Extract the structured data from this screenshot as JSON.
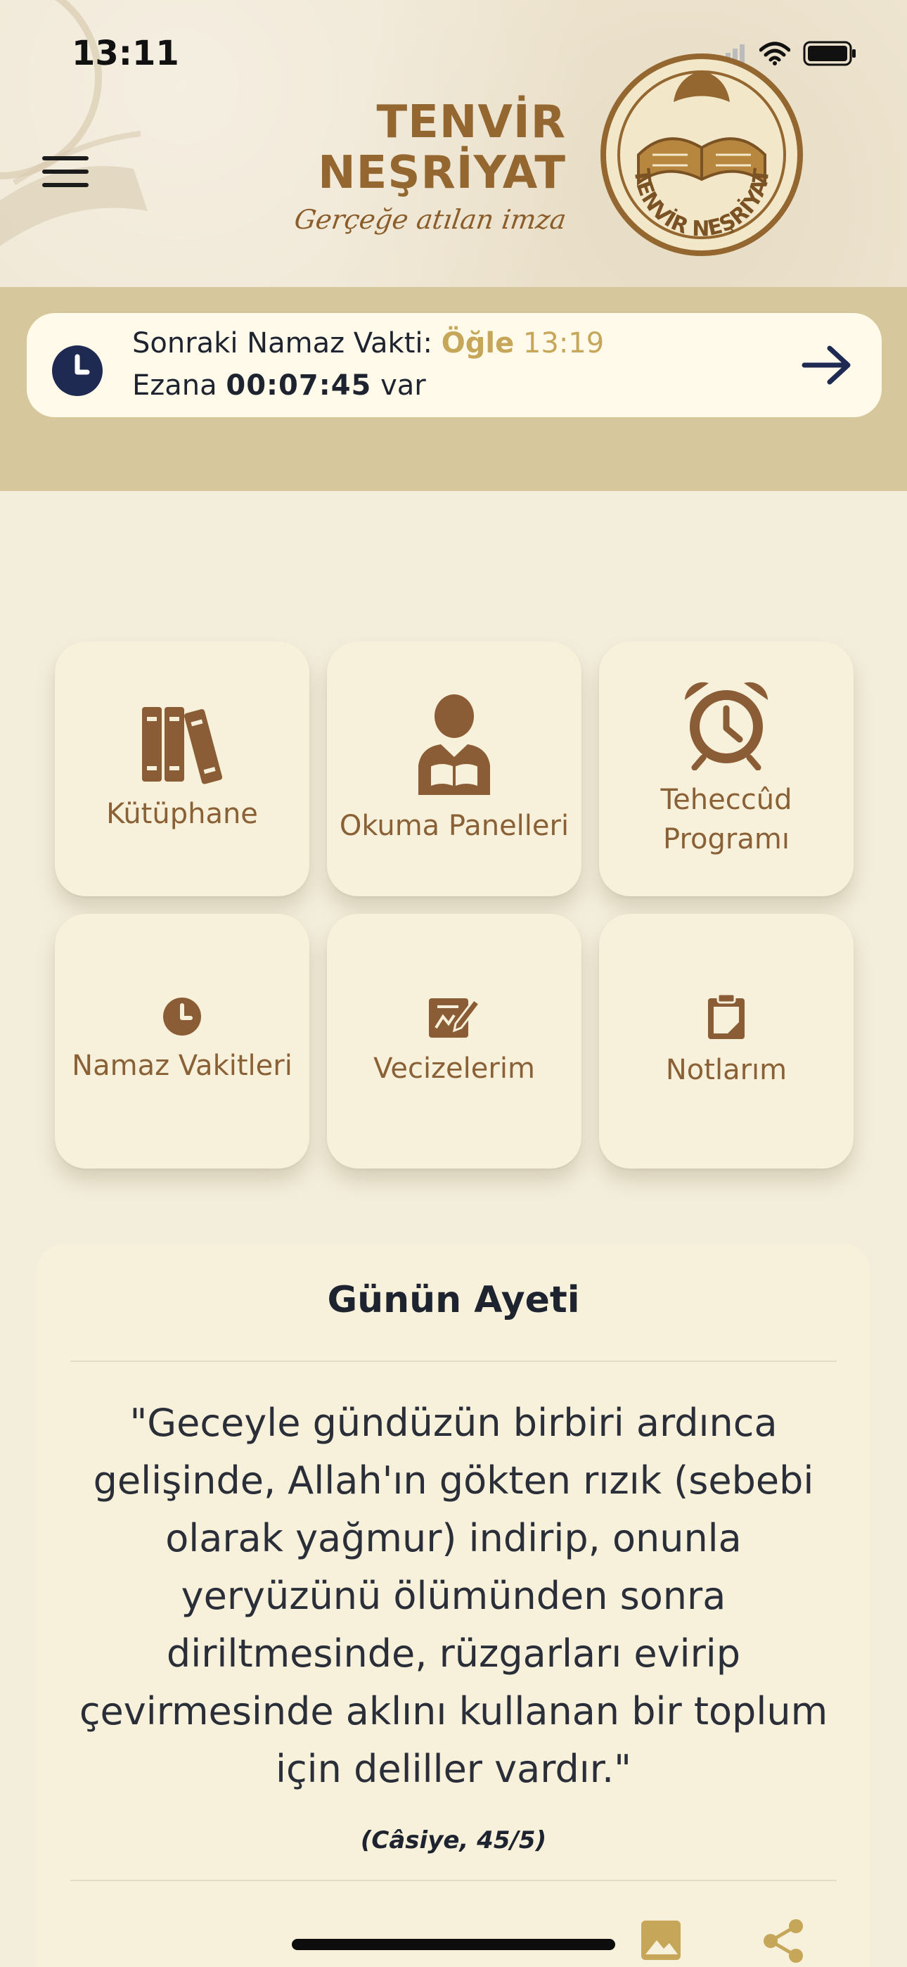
{
  "status_bar": {
    "time": "13:11"
  },
  "brand": {
    "line1": "TENVİR",
    "line2": "NEŞRİYAT",
    "tagline": "Gerçeğe atılan imza",
    "seal_text": "TENVİR NEŞRİYAT"
  },
  "prayer": {
    "prefix": "Sonraki Namaz Vakti:",
    "next_prayer": "Öğle",
    "next_time": "13:19",
    "countdown_prefix": "Ezana",
    "countdown": "00:07:45",
    "countdown_suffix": "var"
  },
  "menu": [
    {
      "label": "Kütüphane",
      "icon": "books-icon"
    },
    {
      "label": "Okuma Panelleri",
      "icon": "reader-icon"
    },
    {
      "label": "Teheccûd\nProgramı",
      "icon": "alarm-clock-icon"
    },
    {
      "label": "Namaz Vakitleri",
      "icon": "clock-icon"
    },
    {
      "label": "Vecizelerim",
      "icon": "pen-edit-icon"
    },
    {
      "label": "Notlarım",
      "icon": "clipboard-icon"
    }
  ],
  "verse": {
    "title": "Günün Ayeti",
    "text": "\"Geceyle gündüzün birbiri ardınca gelişinde, Allah'ın gökten rızık (sebebi olarak yağmur) indirip, onunla yeryüzünü ölümünden sonra diriltmesinde, rüzgarları evirip çevirmesinde aklını kullanan bir toplum için deliller vardır.\"",
    "reference": "(Câsiye, 45/5)"
  },
  "colors": {
    "accent_gold": "#c6a75a",
    "icon_brown": "#8a5d36",
    "navy": "#1f2a52",
    "band": "#d6c89c"
  }
}
